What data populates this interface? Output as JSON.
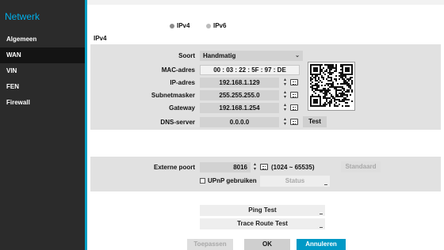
{
  "sidebar": {
    "title": "Netwerk",
    "items": [
      {
        "label": "Algemeen",
        "active": false
      },
      {
        "label": "WAN",
        "active": true
      },
      {
        "label": "VIN",
        "active": false
      },
      {
        "label": "FEN",
        "active": false
      },
      {
        "label": "Firewall",
        "active": false
      }
    ]
  },
  "ip_mode": {
    "ipv4_label": "IPv4",
    "ipv6_label": "IPv6",
    "selected": "IPv4"
  },
  "section_title": "IPv4",
  "form": {
    "type_label": "Soort",
    "type_value": "Handmatig",
    "mac_label": "MAC-adres",
    "mac_value": "00 : 03 : 22 : 5F : 97 : DE",
    "ip_label": "IP-adres",
    "ip_value": "192.168.1.129",
    "subnet_label": "Subnetmasker",
    "subnet_value": "255.255.255.0",
    "gateway_label": "Gateway",
    "gateway_value": "192.168.1.254",
    "dns_label": "DNS-server",
    "dns_value": "0.0.0.0",
    "test_label": "Test"
  },
  "port": {
    "label": "Externe poort",
    "value": "8016",
    "range": "(1024 ~ 65535)",
    "default_label": "Standaard",
    "upnp_label": "UPnP gebruiken",
    "status_label": "Status"
  },
  "tools": {
    "ping_label": "Ping Test",
    "trace_label": "Trace Route Test"
  },
  "footer": {
    "apply_label": "Toepassen",
    "ok_label": "OK",
    "cancel_label": "Annuleren"
  },
  "colors": {
    "accent": "#00a0c6",
    "sidebar_bg": "#2b2b2b",
    "primary_button": "#0099c6"
  },
  "icons": [
    "keyboard-icon",
    "spinner-arrows-icon",
    "dropdown-arrow-icon",
    "qr-code"
  ]
}
